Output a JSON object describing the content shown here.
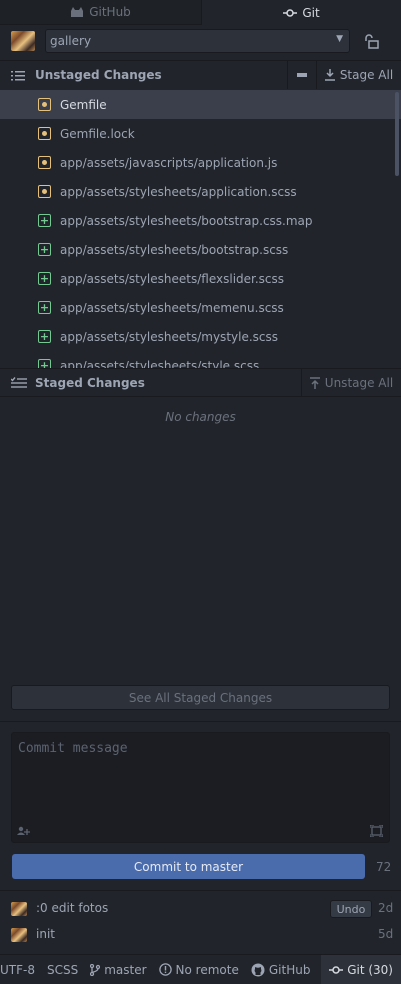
{
  "tabs": [
    {
      "label": "GitHub",
      "icon": "github-icon"
    },
    {
      "label": "Git",
      "icon": "git-commit-icon"
    }
  ],
  "repo": {
    "name": "gallery"
  },
  "unstaged": {
    "title": "Unstaged Changes",
    "stage_all_label": "Stage All",
    "files": [
      {
        "name": "Gemfile",
        "status": "modified"
      },
      {
        "name": "Gemfile.lock",
        "status": "modified"
      },
      {
        "name": "app/assets/javascripts/application.js",
        "status": "modified"
      },
      {
        "name": "app/assets/stylesheets/application.scss",
        "status": "modified"
      },
      {
        "name": "app/assets/stylesheets/bootstrap.css.map",
        "status": "added"
      },
      {
        "name": "app/assets/stylesheets/bootstrap.scss",
        "status": "added"
      },
      {
        "name": "app/assets/stylesheets/flexslider.scss",
        "status": "added"
      },
      {
        "name": "app/assets/stylesheets/memenu.scss",
        "status": "added"
      },
      {
        "name": "app/assets/stylesheets/mystyle.scss",
        "status": "added"
      },
      {
        "name": "app/assets/stylesheets/style.scss",
        "status": "added"
      }
    ]
  },
  "staged": {
    "title": "Staged Changes",
    "unstage_all_label": "Unstage All",
    "empty_text": "No changes",
    "see_all_label": "See All Staged Changes"
  },
  "commit": {
    "placeholder": "Commit message",
    "button_label": "Commit to master",
    "remaining_chars": "72"
  },
  "recent_commits": [
    {
      "message": ":0 edit fotos",
      "time": "2d",
      "undo_label": "Undo"
    },
    {
      "message": "init",
      "time": "5d"
    }
  ],
  "statusbar": {
    "encoding": "UTF-8",
    "grammar": "SCSS",
    "branch": "master",
    "remote": "No remote",
    "github": "GitHub",
    "git": "Git (30)"
  },
  "colors": {
    "modified": "#e5c07b",
    "added": "#73c990",
    "commit_button": "#4a6bac"
  }
}
